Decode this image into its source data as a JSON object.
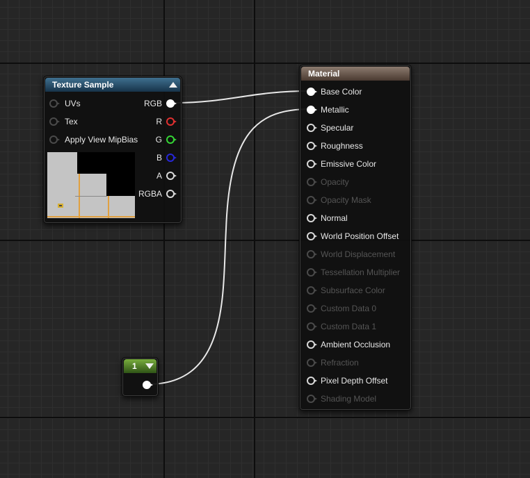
{
  "texture_sample": {
    "title": "Texture Sample",
    "inputs": [
      {
        "label": "UVs"
      },
      {
        "label": "Tex"
      },
      {
        "label": "Apply View MipBias"
      }
    ],
    "outputs": [
      {
        "label": "RGB",
        "color": "#ffffff",
        "connected": true
      },
      {
        "label": "R",
        "color": "#e03030",
        "connected": false
      },
      {
        "label": "G",
        "color": "#35d535",
        "connected": false
      },
      {
        "label": "B",
        "color": "#2727d8",
        "connected": false
      },
      {
        "label": "A",
        "color": "#d8d8d8",
        "connected": false
      },
      {
        "label": "RGBA",
        "color": "#d8d8d8",
        "connected": false
      }
    ],
    "preview_icon": "texture-preview-thumbnail"
  },
  "material": {
    "title": "Material",
    "inputs": [
      {
        "label": "Base Color",
        "enabled": true,
        "connected": true
      },
      {
        "label": "Metallic",
        "enabled": true,
        "connected": true
      },
      {
        "label": "Specular",
        "enabled": true,
        "connected": false
      },
      {
        "label": "Roughness",
        "enabled": true,
        "connected": false
      },
      {
        "label": "Emissive Color",
        "enabled": true,
        "connected": false
      },
      {
        "label": "Opacity",
        "enabled": false,
        "connected": false
      },
      {
        "label": "Opacity Mask",
        "enabled": false,
        "connected": false
      },
      {
        "label": "Normal",
        "enabled": true,
        "connected": false
      },
      {
        "label": "World Position Offset",
        "enabled": true,
        "connected": false
      },
      {
        "label": "World Displacement",
        "enabled": false,
        "connected": false
      },
      {
        "label": "Tessellation Multiplier",
        "enabled": false,
        "connected": false
      },
      {
        "label": "Subsurface Color",
        "enabled": false,
        "connected": false
      },
      {
        "label": "Custom Data 0",
        "enabled": false,
        "connected": false
      },
      {
        "label": "Custom Data 1",
        "enabled": false,
        "connected": false
      },
      {
        "label": "Ambient Occlusion",
        "enabled": true,
        "connected": false
      },
      {
        "label": "Refraction",
        "enabled": false,
        "connected": false
      },
      {
        "label": "Pixel Depth Offset",
        "enabled": true,
        "connected": false
      },
      {
        "label": "Shading Model",
        "enabled": false,
        "connected": false
      }
    ]
  },
  "constant": {
    "value": "1",
    "header_color": "#5a8f2c"
  },
  "connections": [
    {
      "from": "texture_sample.RGB",
      "to": "material.Base Color"
    },
    {
      "from": "constant.output",
      "to": "material.Metallic"
    }
  ],
  "colors": {
    "graph_background": "#262626",
    "texture_header": "#2d5574",
    "material_header": "#6f5e52",
    "constant_header": "#5a8f2c",
    "wire": "#e8e8e8"
  }
}
